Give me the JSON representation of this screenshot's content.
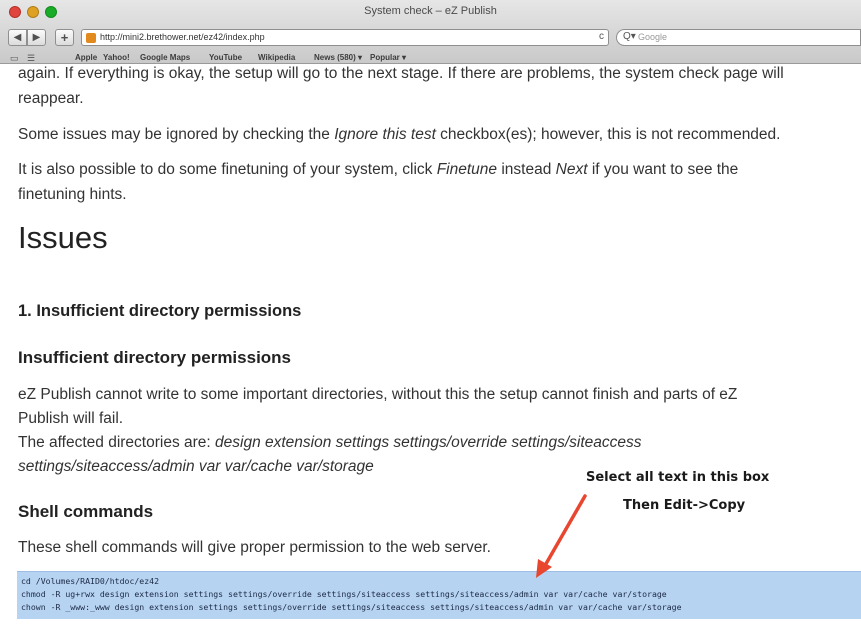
{
  "window": {
    "title": "System check – eZ Publish"
  },
  "toolbar": {
    "back_label": "◀",
    "forward_label": "▶",
    "add_label": "+",
    "url": "http://mini2.brethower.net/ez42/index.php",
    "reload_label": "c",
    "search_placeholder": "Google",
    "search_glass": "Q▾"
  },
  "bookmarks": {
    "items": [
      "Apple",
      "Yahoo!",
      "Google Maps",
      "YouTube",
      "Wikipedia",
      "News (580) ▾",
      "Popular ▾"
    ]
  },
  "page": {
    "intro_line1": "again. If everything is okay, the setup will go to the next stage. If there are problems, the system check page will",
    "intro_line2": "reappear.",
    "ignore_prefix": "Some issues may be ignored by checking the ",
    "ignore_em": "Ignore this test",
    "ignore_suffix": " checkbox(es); however, this is not recommended.",
    "finetune_prefix": "It is also possible to do some finetuning of your system, click ",
    "finetune_em1": "Finetune",
    "finetune_mid": " instead ",
    "finetune_em2": "Next",
    "finetune_suffix": " if you want to see the",
    "finetune_line2": "finetuning hints.",
    "issues_heading": "Issues",
    "issue1_heading": "1. Insufficient directory permissions",
    "perm_heading": "Insufficient directory permissions",
    "perm_line1": "eZ Publish cannot write to some important directories, without this the setup cannot finish and parts of eZ",
    "perm_line2": "Publish will fail.",
    "affected_prefix": "The affected directories are: ",
    "affected_em1": "design extension settings settings/override settings/siteaccess",
    "affected_em2": "settings/siteaccess/admin var var/cache var/storage",
    "shell_heading": "Shell commands",
    "shell_desc": "These shell commands will give proper permission to the web server.",
    "commands": [
      "cd /Volumes/RAID0/htdoc/ez42",
      "chmod -R ug+rwx design extension settings settings/override settings/siteaccess settings/siteaccess/admin var var/cache var/storage",
      "chown -R _www:_www design extension settings settings/override settings/siteaccess settings/siteaccess/admin var var/cache var/storage"
    ]
  },
  "annotation": {
    "line1": "Select all text in this box",
    "line2": "Then Edit->Copy",
    "arrow_color": "#e8462f"
  }
}
